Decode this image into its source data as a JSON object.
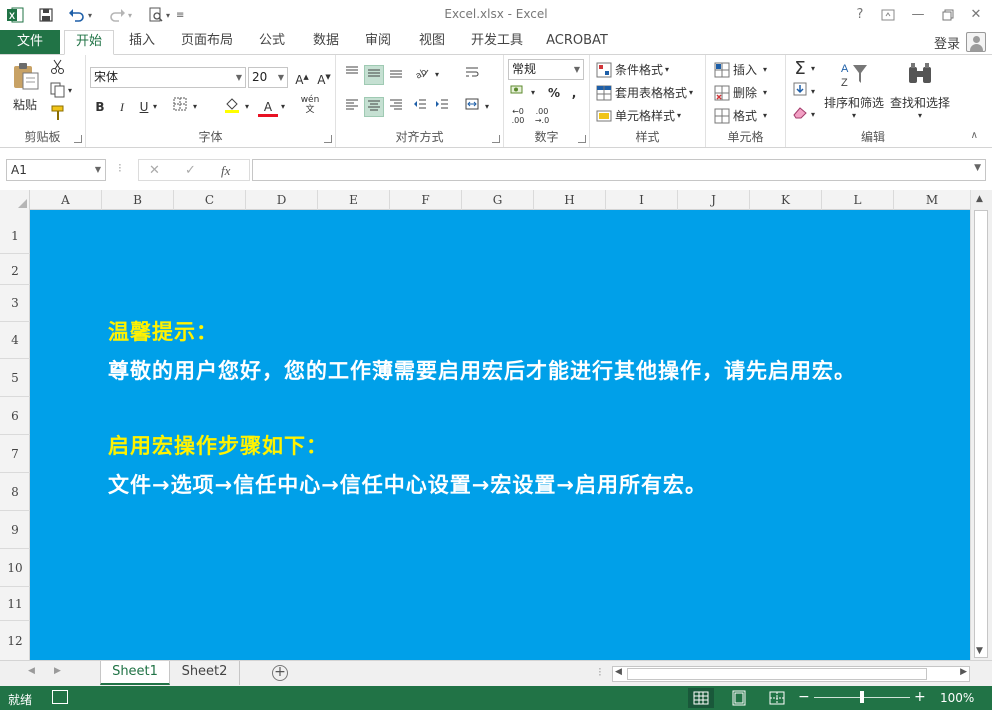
{
  "titlebar": {
    "title": "Excel.xlsx - Excel",
    "help": "?",
    "restore": "□",
    "minimize": "—",
    "maximize": "□",
    "close": "✕"
  },
  "ribbon_tabs": {
    "file": "文件",
    "items": [
      "开始",
      "插入",
      "页面布局",
      "公式",
      "数据",
      "审阅",
      "视图",
      "开发工具",
      "ACROBAT"
    ],
    "login": "登录"
  },
  "ribbon": {
    "clipboard": {
      "label": "剪贴板",
      "paste": "粘贴"
    },
    "font": {
      "label": "字体",
      "name": "宋体",
      "size": "20",
      "bold": "B",
      "italic": "I",
      "underline": "U",
      "wen": "wén"
    },
    "alignment": {
      "label": "对齐方式"
    },
    "number": {
      "label": "数字",
      "format": "常规",
      "percent": "%",
      "comma": ","
    },
    "styles": {
      "label": "样式",
      "conditional": "条件格式",
      "table": "套用表格格式",
      "cell": "单元格样式"
    },
    "cells": {
      "label": "单元格",
      "insert": "插入",
      "delete": "删除",
      "format": "格式"
    },
    "editing": {
      "label": "编辑",
      "sort": "排序和筛选",
      "find": "查找和选择"
    }
  },
  "formula_bar": {
    "name_box": "A1",
    "fx": "fx",
    "value": ""
  },
  "grid": {
    "columns": [
      "A",
      "B",
      "C",
      "D",
      "E",
      "F",
      "G",
      "H",
      "I",
      "J",
      "K",
      "L",
      "M"
    ],
    "rows": [
      "1",
      "2",
      "3",
      "4",
      "5",
      "6",
      "7",
      "8",
      "9",
      "10",
      "11",
      "12"
    ]
  },
  "content": {
    "notice_title": "温馨提示：",
    "notice_body": "尊敬的用户您好，您的工作薄需要启用宏后才能进行其他操作，请先启用宏。",
    "steps_title": "启用宏操作步骤如下：",
    "steps_body": "文件→选项→信任中心→信任中心设置→宏设置→启用所有宏。"
  },
  "sheets": {
    "tabs": [
      "Sheet1",
      "Sheet2"
    ],
    "active": "Sheet1"
  },
  "statusbar": {
    "status": "就绪",
    "zoom": "100%",
    "minus": "−",
    "plus": "+"
  },
  "colors": {
    "brand": "#217346",
    "banner": "#00a0e9",
    "highlight": "#fff200"
  }
}
